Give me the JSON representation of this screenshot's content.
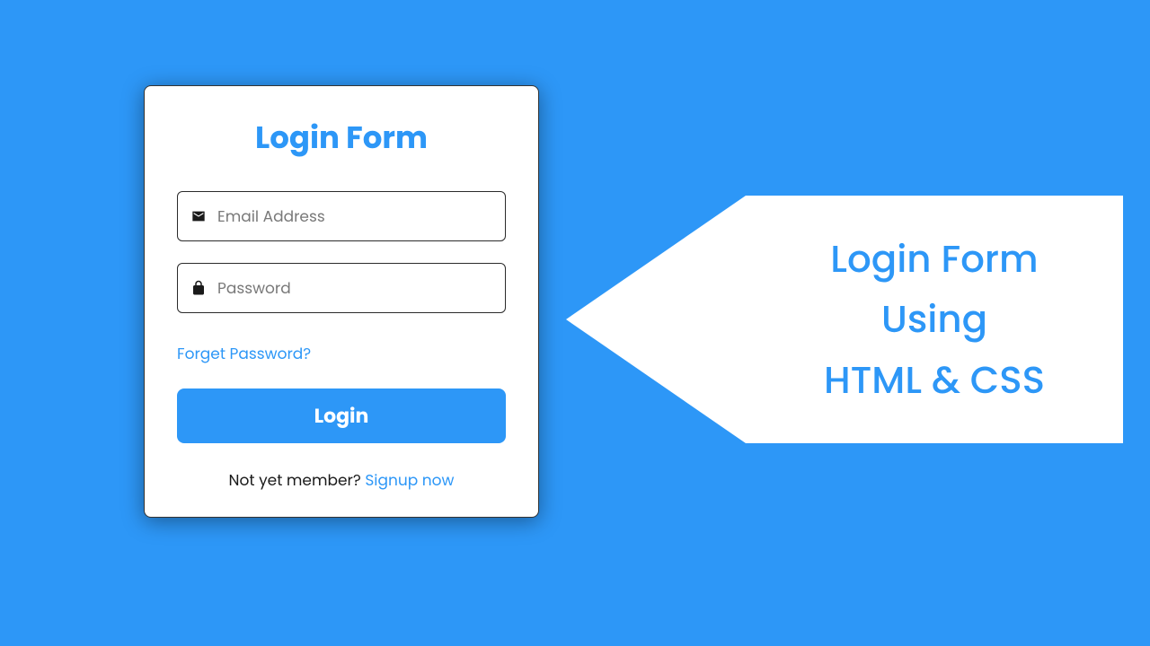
{
  "form": {
    "title": "Login Form",
    "email_placeholder": "Email Address",
    "password_placeholder": "Password",
    "forget_link": "Forget Password?",
    "login_button": "Login",
    "signup_text": "Not yet member? ",
    "signup_link": "Signup now"
  },
  "callout": {
    "line1": "Login Form",
    "line2": "Using",
    "line3": "HTML & CSS"
  },
  "colors": {
    "primary": "#2d97f7",
    "white": "#ffffff"
  }
}
